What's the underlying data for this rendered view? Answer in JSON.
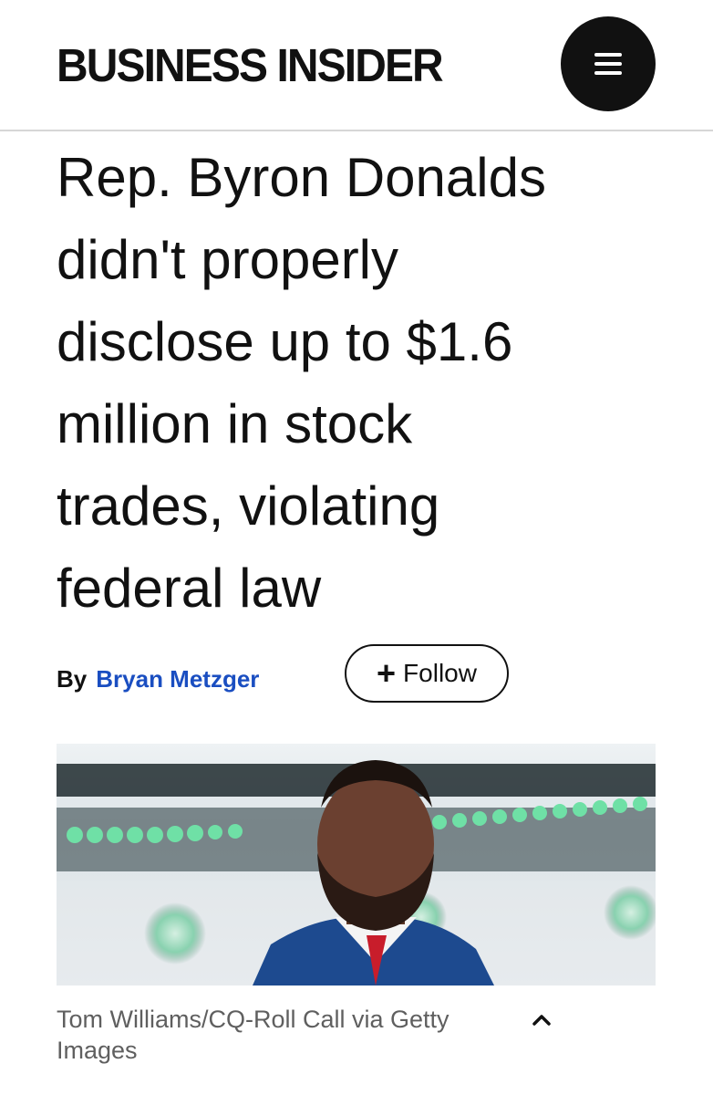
{
  "header": {
    "logo_text": "BUSINESS INSIDER",
    "menu_icon": "hamburger-icon"
  },
  "article": {
    "headline": "Rep. Byron Donalds\ndidn't properly\ndisclose up to $1.6\nmillion in stock\ntrades, violating\nfederal law",
    "byline_prefix": "By",
    "author": "Bryan Metzger",
    "follow_label": "Follow",
    "follow_icon": "plus-icon"
  },
  "photo": {
    "caption": "Tom Williams/CQ-Roll Call via Getty Images",
    "caption_toggle_icon": "chevron-up-icon"
  },
  "colors": {
    "author_link": "#1a4ec1",
    "caption_text": "#5f5f5f",
    "logo": "#111111"
  }
}
